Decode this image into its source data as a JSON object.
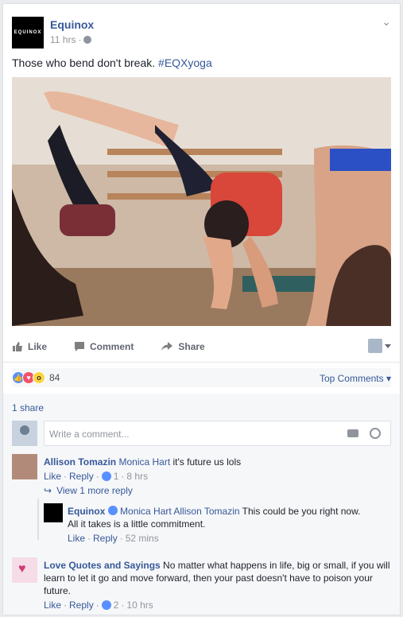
{
  "post": {
    "page_name": "Equinox",
    "logo_text": "EQUINOX",
    "time": "11 hrs",
    "text_plain": "Those who bend don't break. ",
    "hashtag": "#EQXyoga"
  },
  "actions": {
    "like": "Like",
    "comment": "Comment",
    "share": "Share"
  },
  "reactions": {
    "count": "84",
    "sort_label": "Top Comments"
  },
  "shares": "1 share",
  "composer": {
    "placeholder": "Write a comment..."
  },
  "comments": [
    {
      "author": "Allison Tomazin",
      "mention": "Monica Hart",
      "text": " it's future us lols",
      "like_label": "Like",
      "reply_label": "Reply",
      "likes": "1",
      "time": "8 hrs",
      "view_more": "View 1 more reply",
      "reply": {
        "author": "Equinox",
        "mention": "Monica Hart Allison Tomazin",
        "text_line1": " This could be you right now.",
        "text_line2": "All it takes is a little commitment.",
        "like_label": "Like",
        "reply_label": "Reply",
        "time": "52 mins"
      }
    },
    {
      "author": "Love Quotes and Sayings",
      "text": " No matter what happens in life, big or small, if you will learn to let it go and move forward, then your past doesn't have to poison your future.",
      "like_label": "Like",
      "reply_label": "Reply",
      "likes": "2",
      "time": "10 hrs"
    }
  ]
}
